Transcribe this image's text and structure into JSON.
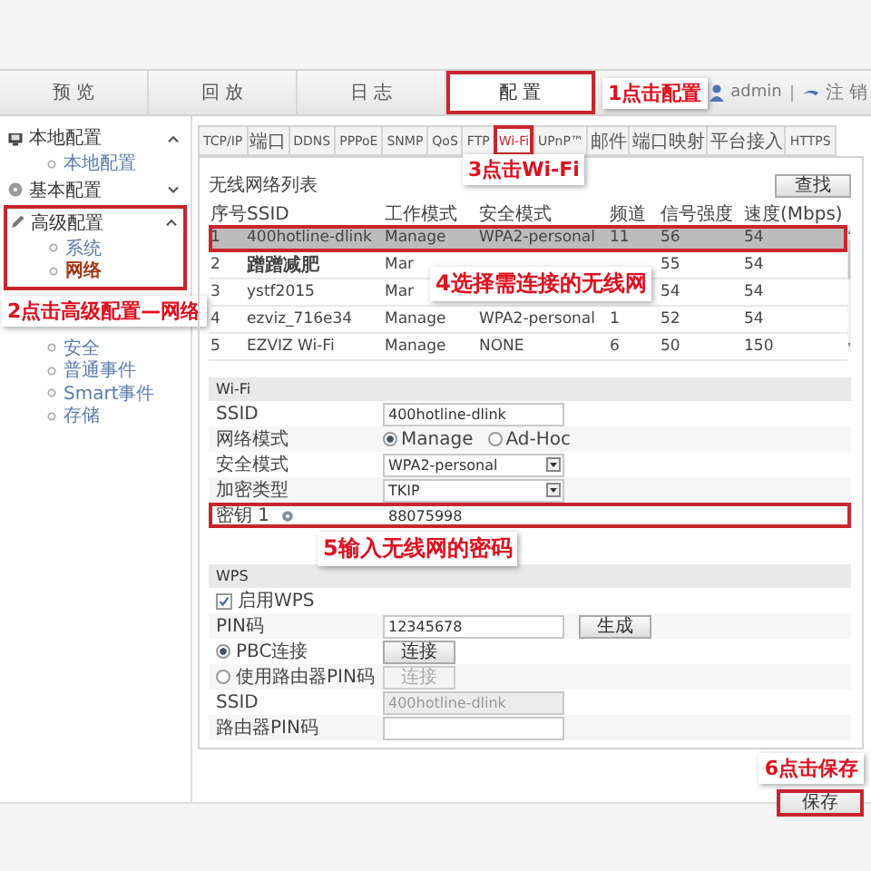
{
  "top_nav": {
    "tabs": [
      {
        "label": "预 览",
        "selected": false,
        "highlighted": false
      },
      {
        "label": "回 放",
        "selected": false,
        "highlighted": false
      },
      {
        "label": "日 志",
        "selected": false,
        "highlighted": false
      },
      {
        "label": "配 置",
        "selected": true,
        "highlighted": true
      }
    ],
    "callout": "1点击配置",
    "user": "admin",
    "logout": "注 销"
  },
  "sidebar": {
    "groups": [
      {
        "label": "本地配置",
        "expanded": true,
        "highlighted": false,
        "children": [
          {
            "label": "本地配置",
            "selected": false
          }
        ]
      },
      {
        "label": "基本配置",
        "expanded": false,
        "highlighted": false
      },
      {
        "label": "高级配置",
        "expanded": true,
        "highlighted": true,
        "children": [
          {
            "label": "系统",
            "selected": false
          },
          {
            "label": "网络",
            "selected": true
          },
          {
            "label": "安全",
            "selected": false
          },
          {
            "label": "普通事件",
            "selected": false
          },
          {
            "label": "Smart事件",
            "selected": false
          },
          {
            "label": "存储",
            "selected": false
          }
        ]
      }
    ],
    "callout": "2点击高级配置—网络"
  },
  "subtabs": [
    {
      "label": "TCP/IP",
      "selected": false,
      "highlighted": false
    },
    {
      "label": "端口",
      "selected": false,
      "highlighted": false
    },
    {
      "label": "DDNS",
      "selected": false,
      "highlighted": false
    },
    {
      "label": "PPPoE",
      "selected": false,
      "highlighted": false
    },
    {
      "label": "SNMP",
      "selected": false,
      "highlighted": false
    },
    {
      "label": "QoS",
      "selected": false,
      "highlighted": false
    },
    {
      "label": "FTP",
      "selected": false,
      "highlighted": false
    },
    {
      "label": "Wi-Fi",
      "selected": true,
      "highlighted": true
    },
    {
      "label": "UPnP™",
      "selected": false,
      "highlighted": false
    },
    {
      "label": "邮件",
      "selected": false,
      "highlighted": false
    },
    {
      "label": "端口映射",
      "selected": false,
      "highlighted": false
    },
    {
      "label": "平台接入",
      "selected": false,
      "highlighted": false
    },
    {
      "label": "HTTPS",
      "selected": false,
      "highlighted": false
    }
  ],
  "subtabs_callout": "3点击Wi-Fi",
  "network_list": {
    "title": "无线网络列表",
    "search_button": "查找",
    "columns": [
      "序号",
      "SSID",
      "工作模式",
      "安全模式",
      "频道",
      "信号强度",
      "速度(Mbps)"
    ],
    "rows": [
      {
        "cells": [
          "1",
          "400hotline-dlink",
          "Manage",
          "WPA2-personal",
          "11",
          "56",
          "54"
        ],
        "selected": true,
        "highlighted": true
      },
      {
        "cells": [
          "2",
          "蹭蹭减肥",
          "Mar",
          null,
          null,
          "55",
          "54"
        ],
        "selected": false,
        "highlighted": false
      },
      {
        "cells": [
          "3",
          "ystf2015",
          "Mar",
          null,
          null,
          "54",
          "54"
        ],
        "selected": false,
        "highlighted": false
      },
      {
        "cells": [
          "4",
          "ezviz_716e34",
          "Manage",
          "WPA2-personal",
          "1",
          "52",
          "54"
        ],
        "selected": false,
        "highlighted": false
      },
      {
        "cells": [
          "5",
          "EZVIZ Wi-Fi",
          "Manage",
          "NONE",
          "6",
          "50",
          "150"
        ],
        "selected": false,
        "highlighted": false
      }
    ],
    "callout": "4选择需连接的无线网"
  },
  "wifi": {
    "title": "Wi-Fi",
    "fields": [
      {
        "kind": "text",
        "label": "SSID",
        "value": "400hotline-dlink",
        "highlighted": false
      },
      {
        "kind": "radios",
        "label": "网络模式",
        "options": [
          {
            "label": "Manage",
            "selected": true
          },
          {
            "label": "Ad-Hoc",
            "selected": false
          }
        ],
        "highlighted": false
      },
      {
        "kind": "select",
        "label": "安全模式",
        "value": "WPA2-personal",
        "highlighted": false
      },
      {
        "kind": "select",
        "label": "加密类型",
        "value": "TKIP",
        "highlighted": false
      },
      {
        "kind": "password",
        "label": "密钥 1",
        "value": "88075998",
        "highlighted": true
      }
    ],
    "callout": "5输入无线网的密码"
  },
  "wps": {
    "title": "WPS",
    "enable": {
      "label": "启用WPS",
      "checked": true
    },
    "rows": [
      {
        "kind": "text_button",
        "label": "PIN码",
        "value": "12345678",
        "button": "生成",
        "disabled": false
      },
      {
        "kind": "radio_button",
        "label": "PBC连接",
        "selected": true,
        "button": "连接",
        "disabled": false
      },
      {
        "kind": "radio_button",
        "label": "使用路由器PIN码",
        "selected": false,
        "button": "连接",
        "disabled": true
      },
      {
        "kind": "text",
        "label": "SSID",
        "value": "400hotline-dlink",
        "disabled": true
      },
      {
        "kind": "text",
        "label": "路由器PIN码",
        "disabled": false
      }
    ]
  },
  "footer": {
    "callout": "6点击保存",
    "save_button": {
      "label": "保存",
      "highlighted": true
    }
  }
}
